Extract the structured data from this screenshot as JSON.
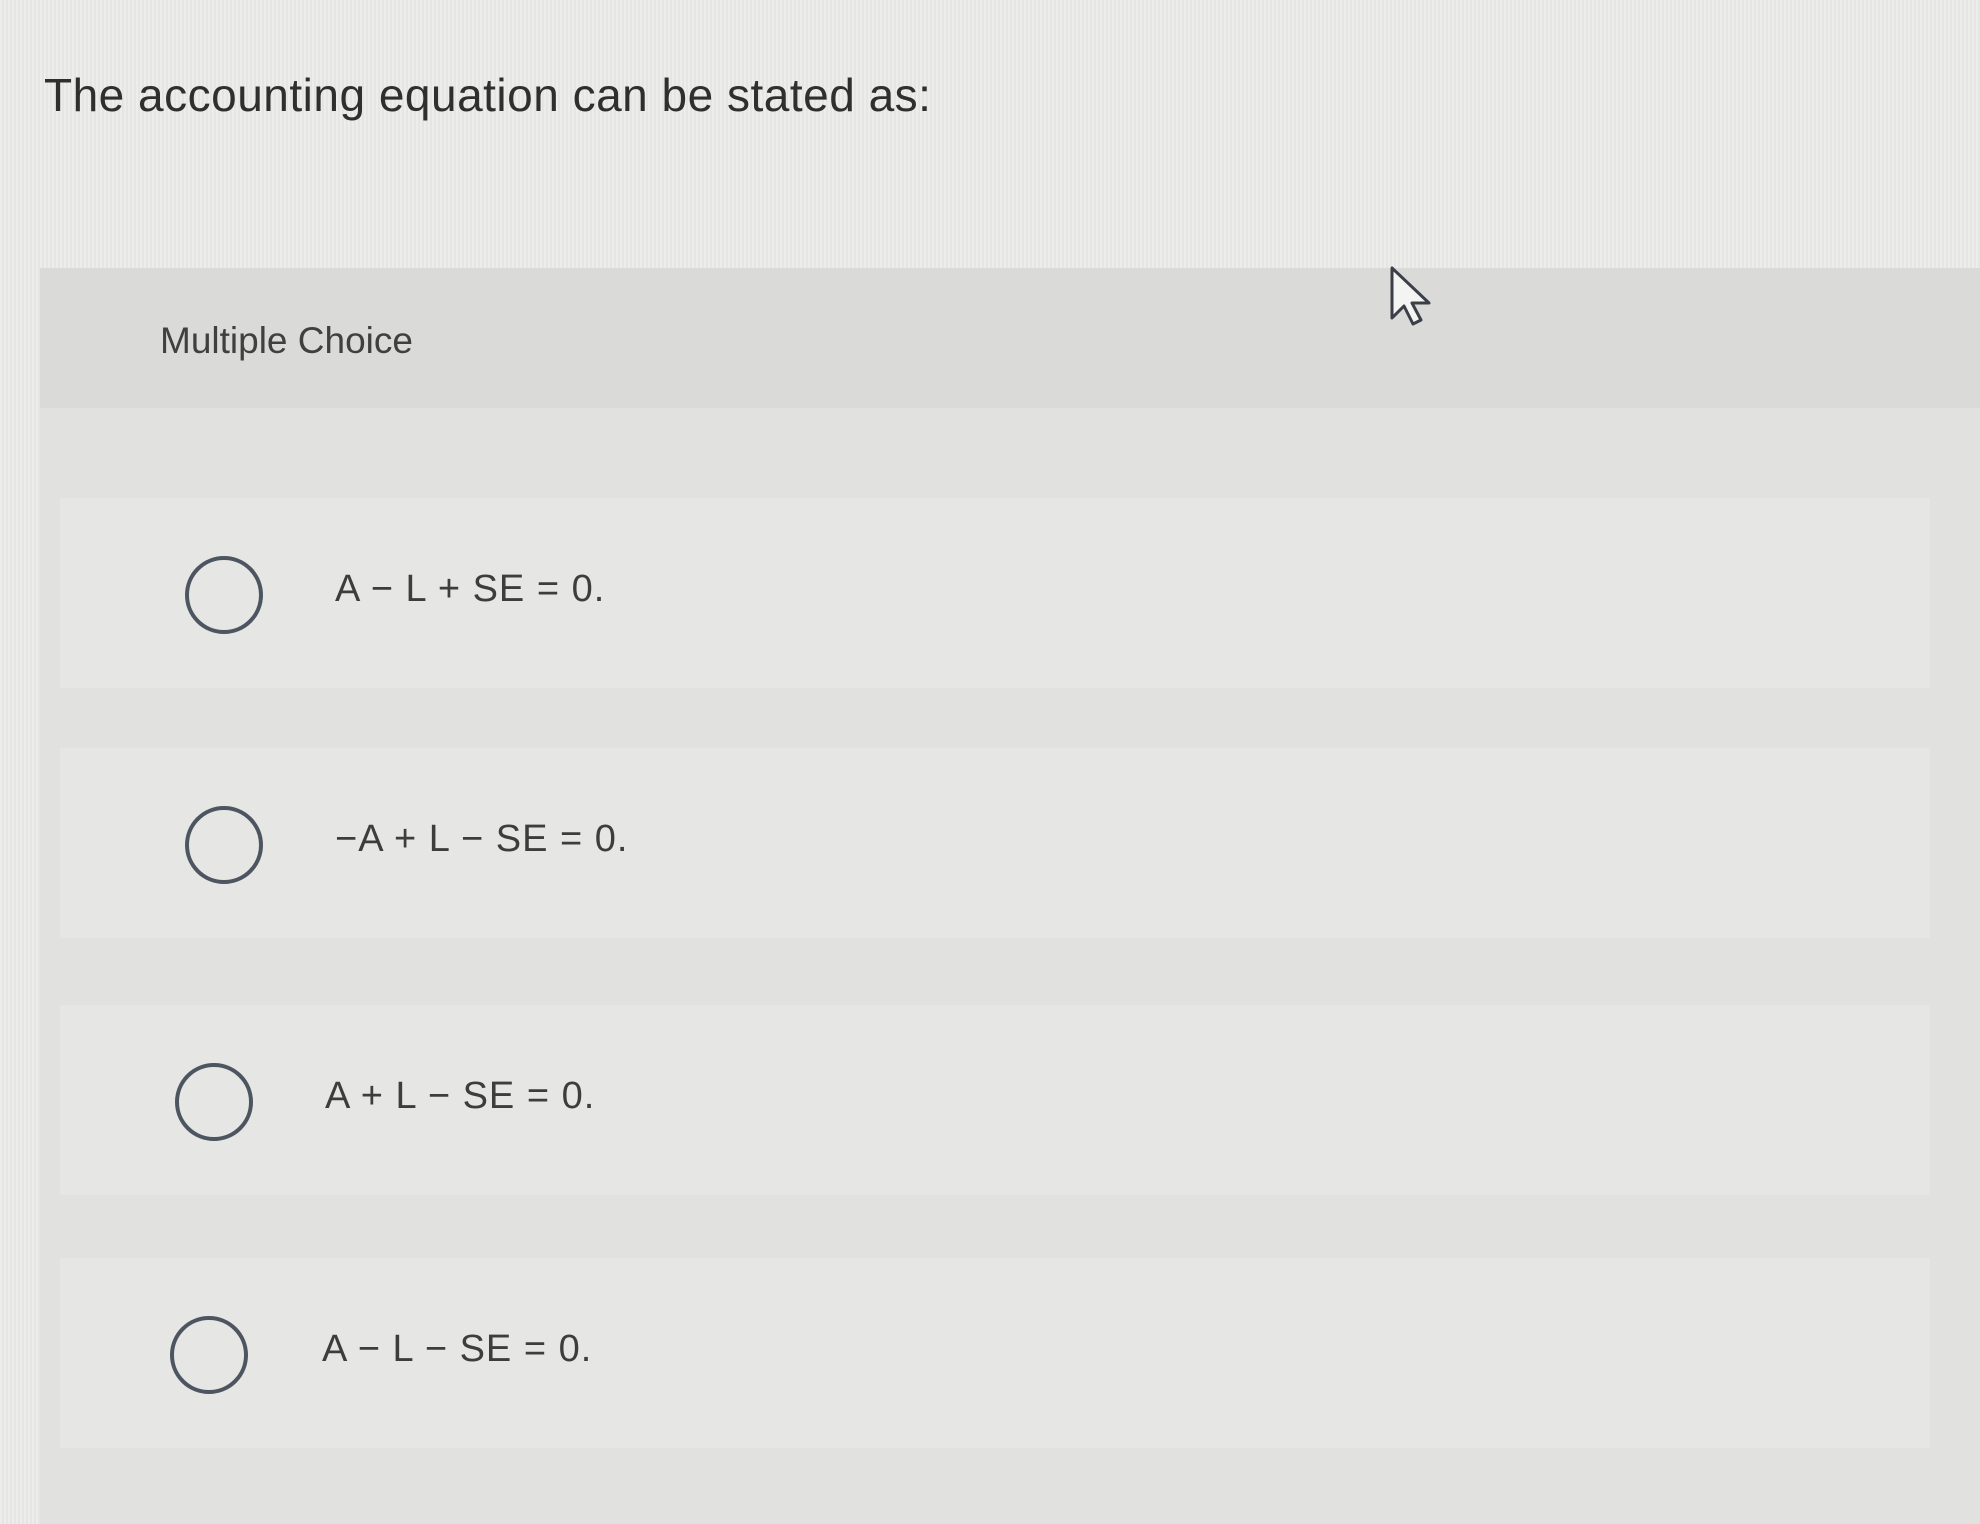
{
  "question": {
    "text": "The accounting equation can be stated as:"
  },
  "choices": {
    "title": "Multiple Choice",
    "options": [
      {
        "label": "A − L + SE = 0."
      },
      {
        "label": "−A + L − SE = 0."
      },
      {
        "label": "A + L − SE = 0."
      },
      {
        "label": "A − L − SE = 0."
      }
    ]
  },
  "icons": {
    "cursor": "mouse-pointer-icon",
    "radio": "radio-unselected-icon"
  },
  "colors": {
    "radio_border": "#4d5561",
    "background": "#e9e9e7"
  }
}
